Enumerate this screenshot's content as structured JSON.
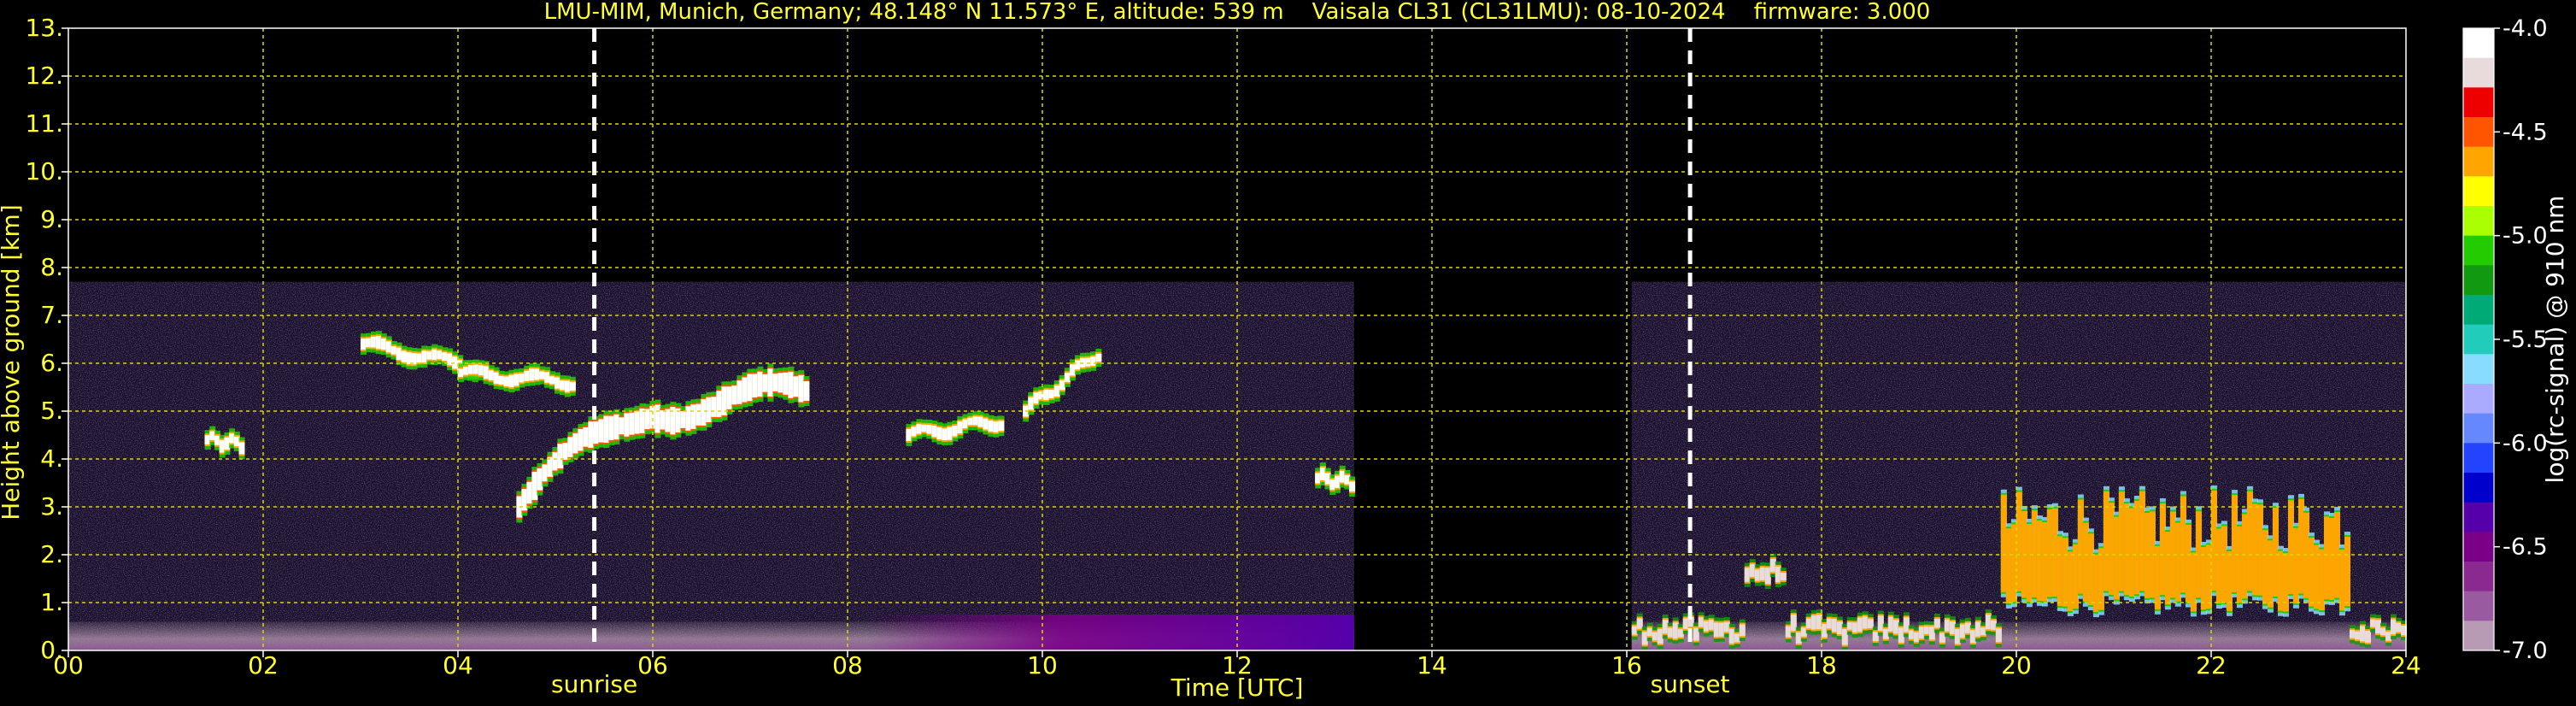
{
  "chart_data": {
    "type": "heatmap",
    "title": "LMU-MIM, Munich, Germany; 48.148° N 11.573° E, altitude: 539 m    Vaisala CL31 (CL31LMU): 08-10-2024    firmware: 3.000",
    "xlabel": "Time [UTC]",
    "ylabel": "Height above ground [km]",
    "xlim": [
      0,
      24
    ],
    "ylim": [
      0,
      13
    ],
    "x_ticks": [
      "00",
      "02",
      "04",
      "06",
      "08",
      "10",
      "12",
      "14",
      "16",
      "18",
      "20",
      "22",
      "24"
    ],
    "y_ticks": [
      "0.",
      "1.",
      "2.",
      "3.",
      "4.",
      "5.",
      "6.",
      "7.",
      "8.",
      "9.",
      "10.",
      "11.",
      "12.",
      "13."
    ],
    "grid": true,
    "grid_color": "#d8d800",
    "text_color": "#ffff33",
    "background": "#000000",
    "measurement_max_height_km": 7.7,
    "data_periods": [
      {
        "start": 0.0,
        "end": 13.2
      },
      {
        "start": 16.05,
        "end": 24.0
      }
    ],
    "events": [
      {
        "label": "sunrise",
        "time": 5.4
      },
      {
        "label": "sunset",
        "time": 16.65
      }
    ],
    "colorbar": {
      "label": "log(rc-signal) @ 910 nm",
      "range": [
        -7.0,
        -4.0
      ],
      "ticks": [
        "-4.0",
        "-4.5",
        "-5.0",
        "-5.5",
        "-6.0",
        "-6.5",
        "-7.0"
      ],
      "colors": [
        "#ffffff",
        "#e9dbdb",
        "#ee0000",
        "#ff5500",
        "#ffa500",
        "#ffff00",
        "#aaff00",
        "#22cc00",
        "#119911",
        "#00aa77",
        "#22ccbb",
        "#88ddff",
        "#aaaaff",
        "#6688ff",
        "#2244ff",
        "#0000cc",
        "#5500aa",
        "#7a0088",
        "#8a2a90",
        "#9a5aa0",
        "#b79ab3"
      ]
    },
    "features": [
      {
        "type": "elevated_layer",
        "start": 3.0,
        "end": 4.2,
        "height_km": [
          6.4,
          5.9
        ]
      },
      {
        "type": "elevated_layer",
        "start": 1.4,
        "end": 1.8,
        "height_km": [
          4.4,
          4.3
        ]
      },
      {
        "type": "elevated_layer",
        "start": 4.0,
        "end": 5.2,
        "height_km": [
          5.8,
          5.6
        ]
      },
      {
        "type": "dense_cloud",
        "start": 4.6,
        "end": 7.6,
        "height_km": [
          3.0,
          5.2
        ]
      },
      {
        "type": "elevated_layer",
        "start": 8.6,
        "end": 9.6,
        "height_km": [
          4.5,
          4.8
        ]
      },
      {
        "type": "elevated_layer",
        "start": 9.8,
        "end": 10.6,
        "height_km": [
          5.0,
          6.3
        ]
      },
      {
        "type": "elevated_layer",
        "start": 12.8,
        "end": 13.2,
        "height_km": [
          3.6,
          3.5
        ]
      },
      {
        "type": "low_clouds",
        "start": 16.05,
        "end": 24.0,
        "height_km": [
          0.2,
          2.7
        ]
      }
    ]
  }
}
